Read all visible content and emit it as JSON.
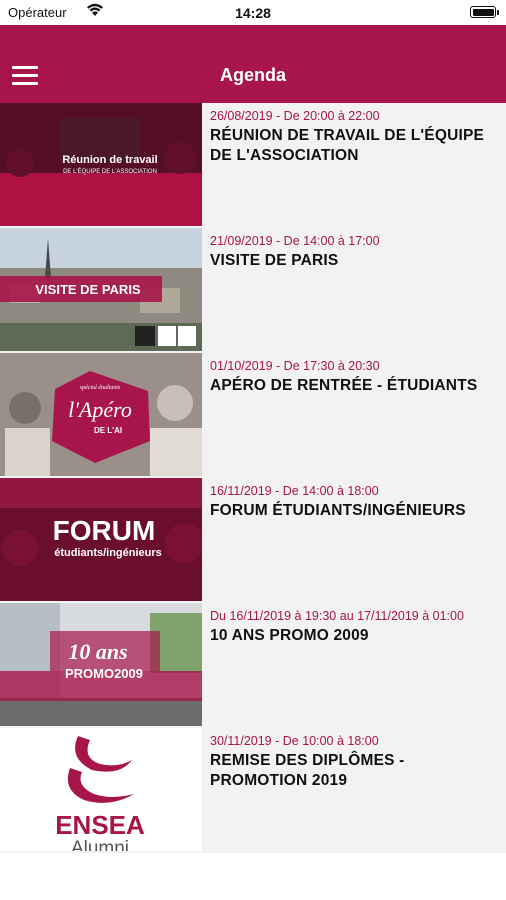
{
  "status_bar": {
    "carrier": "Opérateur",
    "time": "14:28"
  },
  "nav": {
    "title": "Agenda",
    "menu_icon": "hamburger-icon"
  },
  "colors": {
    "brand": "#a8154a",
    "row_bg": "#f2f2f2"
  },
  "events": [
    {
      "date": "26/08/2019 - De 20:00 à 22:00",
      "title": "RÉUNION DE TRAVAIL DE L'ÉQUIPE DE L'ASSOCIATION",
      "image_text": [
        "Réunion de travail",
        "DE L'ÉQUIPE DE L'ASSOCIATION"
      ]
    },
    {
      "date": "21/09/2019 - De 14:00 à 17:00",
      "title": "VISITE DE PARIS",
      "image_text": [
        "VISITE DE PARIS"
      ]
    },
    {
      "date": "01/10/2019 - De 17:30 à 20:30",
      "title": "APÉRO DE RENTRÉE - ÉTUDIANTS",
      "image_text": [
        "spécial étudiants",
        "l'Apéro",
        "DE L'AI"
      ]
    },
    {
      "date": "16/11/2019 - De 14:00 à 18:00",
      "title": "FORUM ÉTUDIANTS/INGÉNIEURS",
      "image_text": [
        "FORUM",
        "étudiants/ingénieurs"
      ]
    },
    {
      "date": "Du 16/11/2019 à 19:30 au 17/11/2019 à 01:00",
      "title": "10 ANS PROMO 2009",
      "image_text": [
        "10 ans",
        "PROMO2009"
      ]
    },
    {
      "date": "30/11/2019 - De 10:00 à 18:00",
      "title": "REMISE DES DIPLÔMES - PROMOTION 2019",
      "image_text": [
        "ENSEA",
        "Alumni"
      ]
    }
  ]
}
